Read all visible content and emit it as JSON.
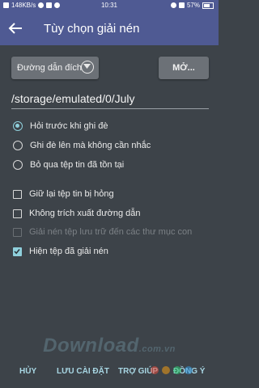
{
  "status_bar": {
    "network_speed": "148KB/s",
    "time": "10:31",
    "battery": "57%"
  },
  "app_bar": {
    "title": "Tùy chọn giải nén",
    "back_icon": "arrow-left-icon"
  },
  "destination": {
    "label": "Đường dẫn đích",
    "open_button": "MỞ...",
    "path": "/storage/emulated/0/July"
  },
  "overwrite_options": [
    {
      "label": "Hỏi trước khi ghi đè",
      "selected": true
    },
    {
      "label": "Ghi đè lên mà không cần nhắc",
      "selected": false
    },
    {
      "label": "Bỏ qua tệp tin đã tồn tại",
      "selected": false
    }
  ],
  "checkbox_options": [
    {
      "label": "Giữ lại tệp tin bị hỏng",
      "checked": false,
      "enabled": true
    },
    {
      "label": "Không trích xuất đường dẫn",
      "checked": false,
      "enabled": true
    },
    {
      "label": "Giải nén tệp lưu trữ đến các thư mục con",
      "checked": false,
      "enabled": false
    },
    {
      "label": "Hiện tệp đã giải nén",
      "checked": true,
      "enabled": true
    }
  ],
  "watermark": {
    "main": "Download",
    "suffix": ".com.vn"
  },
  "footer": {
    "cancel": "HỦY",
    "save_settings": "LƯU CÀI ĐẶT",
    "help": "TRỢ GIÚP",
    "ok": "ĐỒNG Ý"
  },
  "colors": {
    "accent": "#8fd0dc",
    "app_bar": "#4f5a93",
    "background": "#3d4349",
    "watermark_dots": [
      "#e74c3c",
      "#f39c12",
      "#2ecc71",
      "#3498db"
    ]
  }
}
